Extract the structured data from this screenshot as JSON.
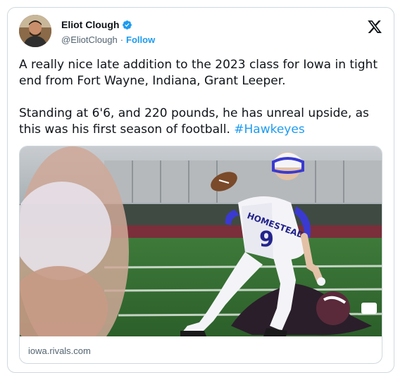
{
  "author": {
    "name": "Eliot Clough",
    "handle": "@EliotClough",
    "separator": "·",
    "follow_label": "Follow"
  },
  "tweet": {
    "paragraph1": "A really nice late addition to the 2023 class for Iowa in tight end from Fort Wayne, Indiana, Grant Leeper.",
    "paragraph2_text": "Standing at 6'6, and 220 pounds, he has unreal upside, as this was his first season of football. ",
    "hashtag": "#Hawkeyes"
  },
  "media": {
    "jersey_text": "HOMESTEAD",
    "jersey_number": "9",
    "link_domain": "iowa.rivals.com"
  },
  "colors": {
    "accent": "#1d9bf0",
    "text": "#0f1419",
    "muted": "#536471",
    "border": "#cfd9de"
  },
  "icons": [
    "verified-badge-icon",
    "x-logo-icon"
  ]
}
